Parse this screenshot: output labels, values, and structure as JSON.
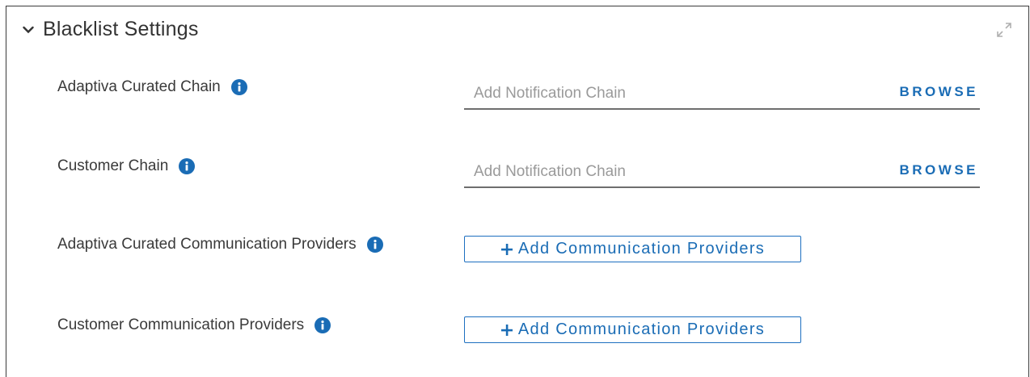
{
  "section": {
    "title": "Blacklist Settings",
    "collapse_icon": "chevron-down-icon",
    "expand_icon": "expand-arrows-icon"
  },
  "fields": [
    {
      "label": "Adaptiva Curated Chain",
      "placeholder": "Add Notification Chain",
      "action": "BROWSE",
      "info_icon": "info-icon"
    },
    {
      "label": "Customer Chain",
      "placeholder": "Add Notification Chain",
      "action": "BROWSE",
      "info_icon": "info-icon"
    }
  ],
  "providers": [
    {
      "label": "Adaptiva Curated Communication Providers",
      "button": "Add Communication Providers",
      "info_icon": "info-icon"
    },
    {
      "label": "Customer Communication Providers",
      "button": "Add Communication Providers",
      "info_icon": "info-icon"
    }
  ],
  "colors": {
    "accent": "#1a6cb5",
    "text": "#333333",
    "placeholder": "#9a9a9a",
    "underline": "#6e6e6e",
    "border": "#3b3b3b"
  }
}
